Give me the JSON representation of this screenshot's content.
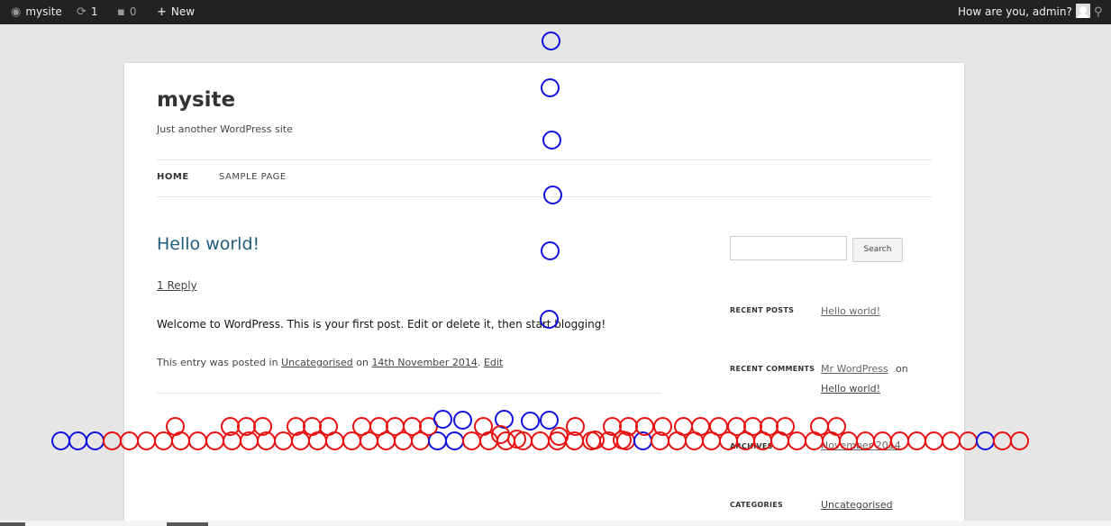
{
  "adminbar": {
    "site_name": "mysite",
    "updates_count": "1",
    "comments_count": "0",
    "new_label": "New",
    "greeting": "How are you, admin?",
    "colors": {
      "background": "#222222",
      "text": "#eeeeee"
    }
  },
  "header": {
    "site_title": "mysite",
    "tagline": "Just another WordPress site"
  },
  "nav": {
    "items": [
      "HOME",
      "SAMPLE PAGE"
    ]
  },
  "post": {
    "title": "Hello world!",
    "reply_link": "1 Reply",
    "body": "Welcome to WordPress. This is your first post. Edit or delete it, then start blogging!",
    "meta_prefix": "This entry was posted in ",
    "meta_category": "Uncategorised",
    "meta_on": " on ",
    "meta_date": "14th November 2014",
    "meta_edit": "Edit"
  },
  "sidebar": {
    "search_value": "",
    "search_button": "Search",
    "recent_posts_title": "RECENT POSTS",
    "recent_posts": [
      "Hello world!"
    ],
    "recent_comments_title": "RECENT COMMENTS",
    "recent_comment_author": "Mr WordPress",
    "recent_comment_on": "on",
    "recent_comment_post": "Hello world!",
    "archives_title": "ARCHIVES",
    "archive_item": "November 2014",
    "categories_title": "CATEGORIES",
    "category_item": "Uncategorised"
  },
  "theme": {
    "link_color": "#1e5b7c",
    "overlay_blue": "#1010e0",
    "overlay_red": "#e81010"
  }
}
